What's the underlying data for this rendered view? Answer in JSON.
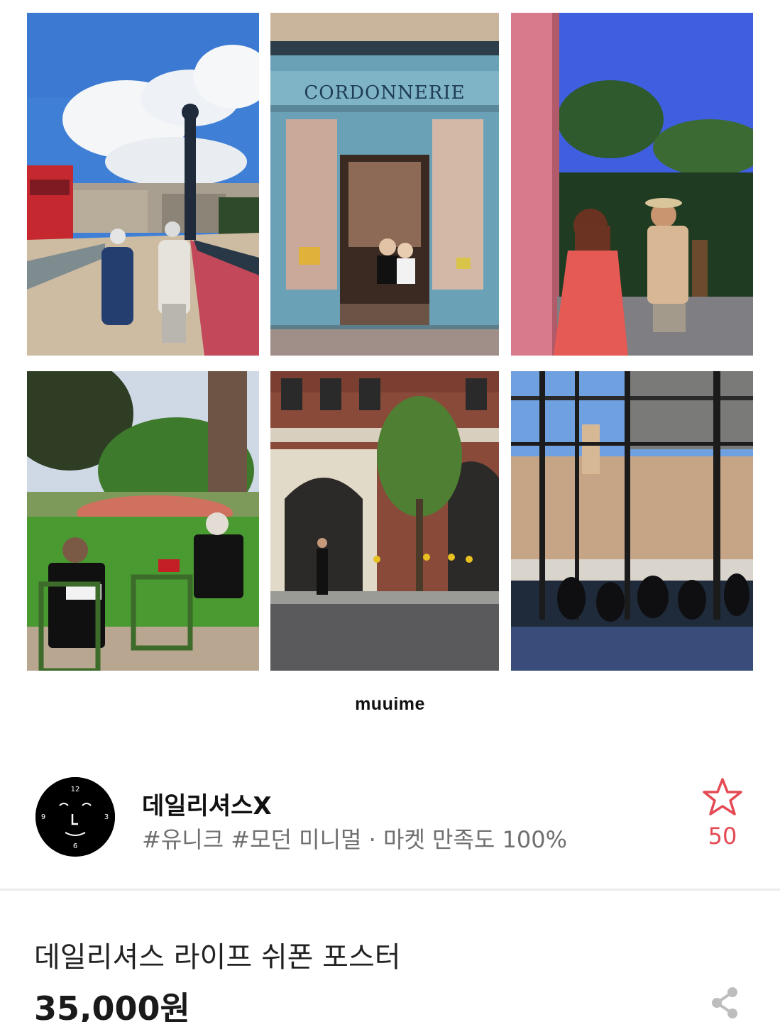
{
  "gallery": {
    "shop_sign": "CORDONNERIE",
    "brand_mark": "muuime"
  },
  "seller": {
    "name": "데일리셔스X",
    "tags": "#유니크 #모던 미니멀 · 마켓 만족도 100%",
    "favorite_count": "50",
    "avatar_icon": "clock-face-avatar",
    "clock_numbers": [
      "12",
      "3",
      "6",
      "9"
    ]
  },
  "product": {
    "title": "데일리셔스 라이프 쉬폰 포스터",
    "price": "35,000원"
  },
  "icons": {
    "favorite": "star-outline-icon",
    "share": "share-icon"
  },
  "colors": {
    "accent": "#e34a54",
    "muted_text": "#6f6f6f"
  }
}
